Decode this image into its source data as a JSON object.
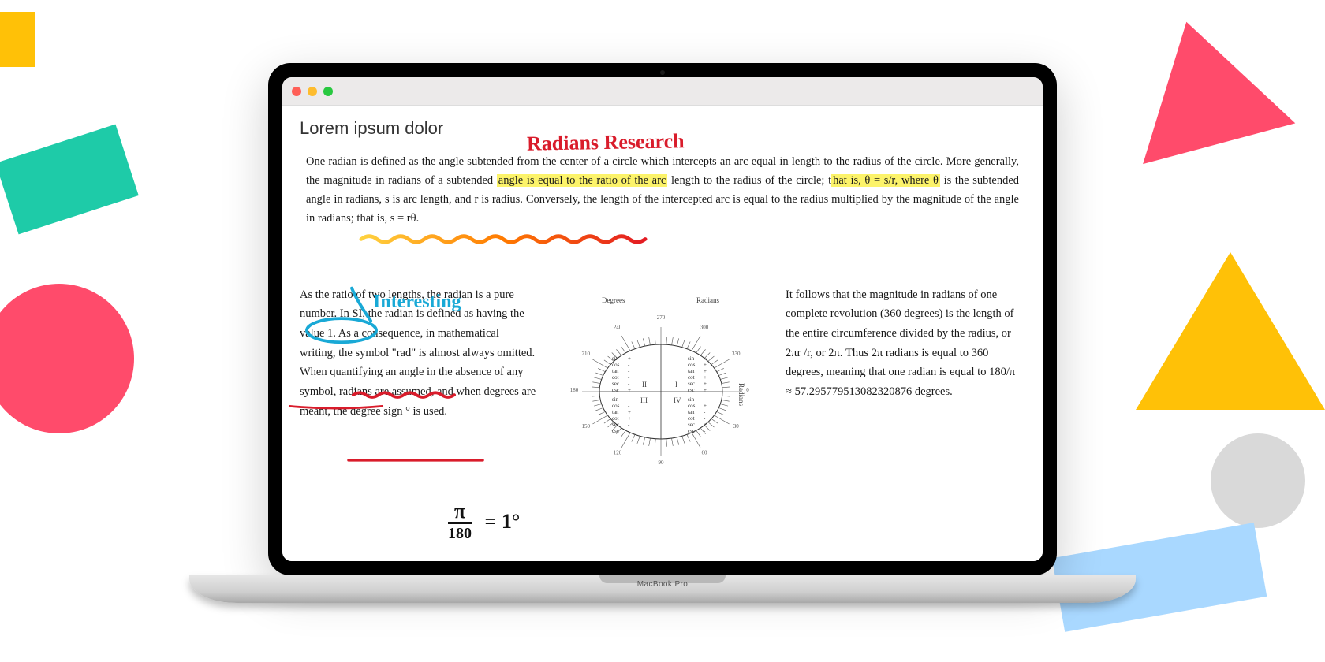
{
  "laptop_label": "MacBook Pro",
  "window": {
    "page_title": "Lorem ipsum dolor"
  },
  "intro": {
    "pre1": "One radian is defined as the angle subtended from the center of a circle which intercepts an arc equal in length to the radius of the circle. More generally, the magnitude in radians of a subtended ",
    "hl1": "angle is equal to the ratio of the arc",
    "mid1": " length to the radius of the circle; t",
    "hl2": "hat is, θ = s/r, where θ",
    "post1": " is the subtended angle in radians, s is arc length, and r is radius. Conversely, the length of the inter­cepted arc is equal to the radius multiplied by the magnitude of the angle in radians; that is, s = rθ."
  },
  "left_para": "As the ratio of two lengths, the radian is a pure number. In SI, the radian is defined as having the value 1. As a consequence, in mathematical writing, the symbol \"rad\" is almost always omitted. When quantifying an angle in the absence of any symbol, radians are assumed, and when degrees are meant, the degree sign ° is used.",
  "right_para": "It follows that the magnitude in radians of one complete revolution (360 degrees) is the length of the entire circumference divided by the radius, or 2πr /r, or 2π. Thus 2π radians is equal to 360 degrees, meaning that one radian is equal to 180/π ≈ 57.295779513082320876 degrees.",
  "handwriting": {
    "title": "Radians  Research",
    "note_interesting": "Interesting",
    "formula_top": "π",
    "formula_bottom": "180",
    "formula_rhs": "= 1°"
  },
  "protractor": {
    "label_degrees": "Degrees",
    "label_radians": "Radians",
    "quadrant_labels": [
      "I",
      "II",
      "III",
      "IV"
    ],
    "trig_rows": [
      "sin",
      "cos",
      "tan",
      "cot",
      "sec",
      "csc"
    ]
  }
}
